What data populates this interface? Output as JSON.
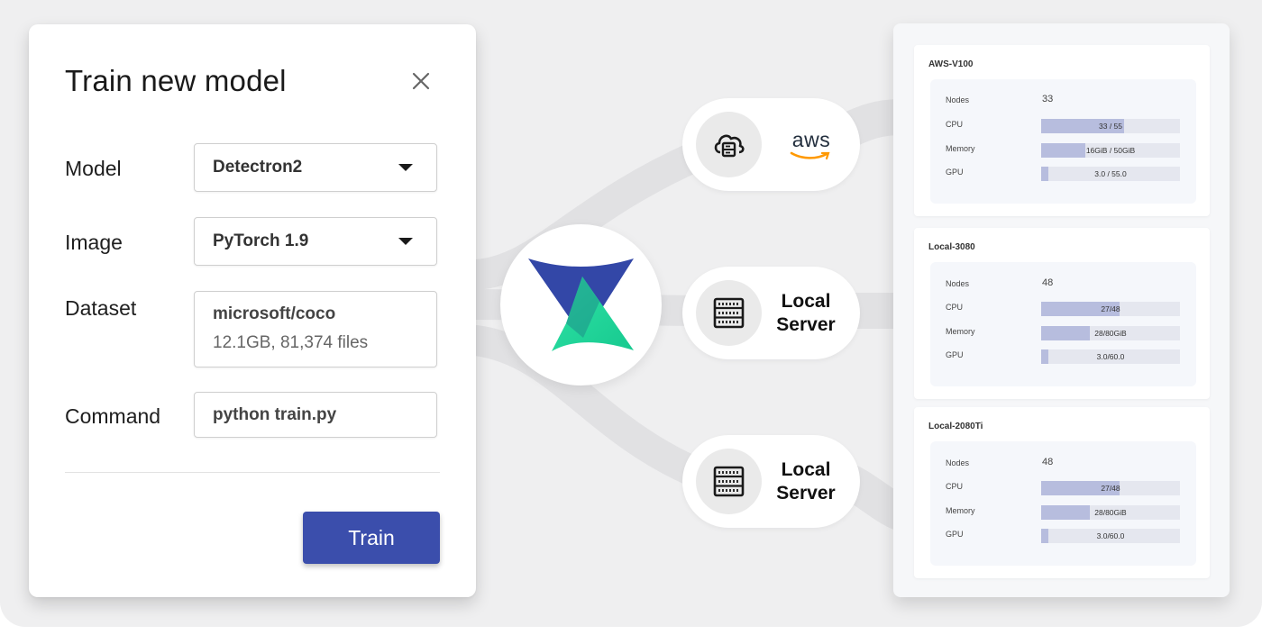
{
  "dialog": {
    "title": "Train new model",
    "fields": {
      "model": {
        "label": "Model",
        "value": "Detectron2"
      },
      "image": {
        "label": "Image",
        "value": "PyTorch 1.9"
      },
      "dataset": {
        "label": "Dataset",
        "name": "microsoft/coco",
        "meta": "12.1GB, 81,374 files"
      },
      "command": {
        "label": "Command",
        "value": "python train.py"
      }
    },
    "train_label": "Train"
  },
  "targets": [
    {
      "label": "aws",
      "icon": "cloud-server-icon"
    },
    {
      "label": "Local Server",
      "line1": "Local",
      "line2": "Server",
      "icon": "server-rack-icon"
    },
    {
      "label": "Local Server",
      "line1": "Local",
      "line2": "Server",
      "icon": "server-rack-icon"
    }
  ],
  "colors": {
    "primary_button": "#3b4eac",
    "logo_blue": "#3347a7",
    "logo_green": "#21d59b",
    "bar_fill": "#b7bdde",
    "bar_track": "#e5e7ef"
  },
  "resources": [
    {
      "name": "AWS-V100",
      "nodes_label": "Nodes",
      "nodes": "33",
      "metrics": [
        {
          "label": "CPU",
          "text": "33 / 55",
          "fraction": 0.6
        },
        {
          "label": "Memory",
          "text": "16GiB / 50GiB",
          "fraction": 0.32
        },
        {
          "label": "GPU",
          "text": "3.0 / 55.0",
          "fraction": 0.055
        }
      ]
    },
    {
      "name": "Local-3080",
      "nodes_label": "Nodes",
      "nodes": "48",
      "metrics": [
        {
          "label": "CPU",
          "text": "27/48",
          "fraction": 0.5625
        },
        {
          "label": "Memory",
          "text": "28/80GiB",
          "fraction": 0.35
        },
        {
          "label": "GPU",
          "text": "3.0/60.0",
          "fraction": 0.05
        }
      ]
    },
    {
      "name": "Local-2080Ti",
      "nodes_label": "Nodes",
      "nodes": "48",
      "metrics": [
        {
          "label": "CPU",
          "text": "27/48",
          "fraction": 0.5625
        },
        {
          "label": "Memory",
          "text": "28/80GiB",
          "fraction": 0.35
        },
        {
          "label": "GPU",
          "text": "3.0/60.0",
          "fraction": 0.05
        }
      ]
    }
  ]
}
